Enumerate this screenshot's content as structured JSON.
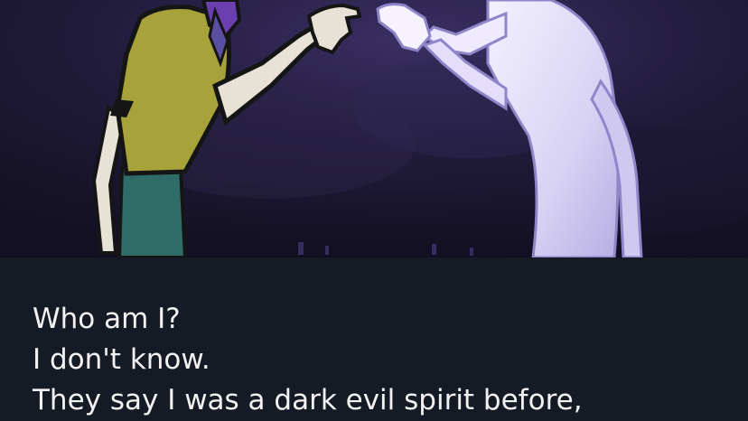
{
  "scene": {
    "image": "two-figures-reaching-hands"
  },
  "dialogue": {
    "lines": [
      "Who am I?",
      "I don't know.",
      "They say I was a dark evil spirit before,"
    ]
  },
  "colors": {
    "background": "#131a22",
    "text": "#f2f2f2"
  }
}
